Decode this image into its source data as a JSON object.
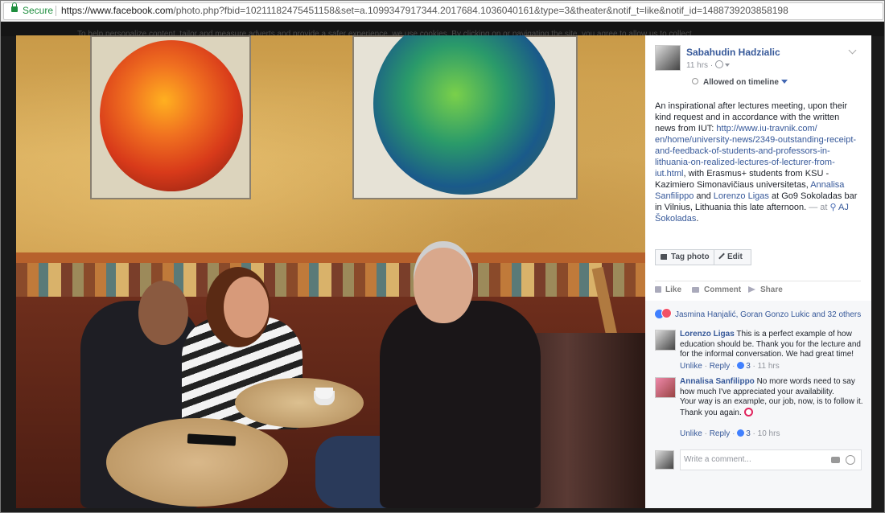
{
  "browser": {
    "secure_label": "Secure",
    "url_host": "https://www.facebook.com",
    "url_rest": "/photo.php?fbid=10211182475451158&set=a.1099347917344.2017684.1036040161&type=3&theater&notif_t=like&notif_id=1488739203858198"
  },
  "background_page": {
    "cookie_text": "To help personalize content, tailor and measure adverts and provide a safer experience, we use cookies. By clicking on or navigating the site, you agree to allow us to collect"
  },
  "post": {
    "author": "Sabahudin Hadzialic",
    "time": "11 hrs",
    "dot": "·",
    "audience_icon": "globe-icon",
    "allowed_label": "Allowed on timeline",
    "caption": {
      "p1": "An inspirational after lectures meeting, upon their kind request and in accordance with the written news from IUT: ",
      "link": "http://www.iu-travnik.com/en/home/university-news/2349-outstanding-receipt-and-feedback-of-students-and-professors-in-lithuania-on-realized-lectures-of-lecturer-from-iut.html",
      "link_lines": [
        "http://www.iu-travnik.com/",
        "en/home/university-news/2349-outstanding-receipt-",
        "and-feedback-of-students-and-professors-in-",
        "lithuania-on-realized-lectures-of-lecturer-from-",
        "iut.html"
      ],
      "p2": ", with Erasmus+ students from KSU - Kazimiero Simonavičiaus universitetas, ",
      "tag1": "Annalisa Sanfilippo",
      "and": " and ",
      "tag2": "Lorenzo Ligas",
      "p3": " at Go9 Sokoladas bar in Vilnius, Lithuania this late afternoon. ",
      "at": "— at ",
      "place": "AJ Šokoladas",
      "period": "."
    },
    "buttons": {
      "tag": "Tag photo",
      "edit": "Edit"
    },
    "actions": {
      "like": "Like",
      "comment": "Comment",
      "share": "Share"
    },
    "reactions_text": "Jasmina Hanjalić, Goran Gonzo Lukic and 32 others",
    "comments": [
      {
        "name": "Lorenzo Ligas",
        "text": "This is a perfect example of how education should be. Thank you for the lecture and for the informal conversation. We had great time!",
        "unlike": "Unlike",
        "reply": "Reply",
        "likes": "3",
        "time": "11 hrs",
        "dot": "·"
      },
      {
        "name": "Annalisa Sanfilippo",
        "text": "No more words need to say how much I've appreciated your availability.",
        "text2": "Your way is an example, our job, now, is to follow it.",
        "text3": "Thank you again.",
        "unlike": "Unlike",
        "reply": "Reply",
        "likes": "3",
        "time": "10 hrs",
        "dot": "·"
      }
    ],
    "write_placeholder": "Write a comment..."
  },
  "colors": {
    "link": "#365899",
    "secure": "#1e8e3e",
    "like_blue": "#4080ff",
    "love_red": "#f25268"
  }
}
